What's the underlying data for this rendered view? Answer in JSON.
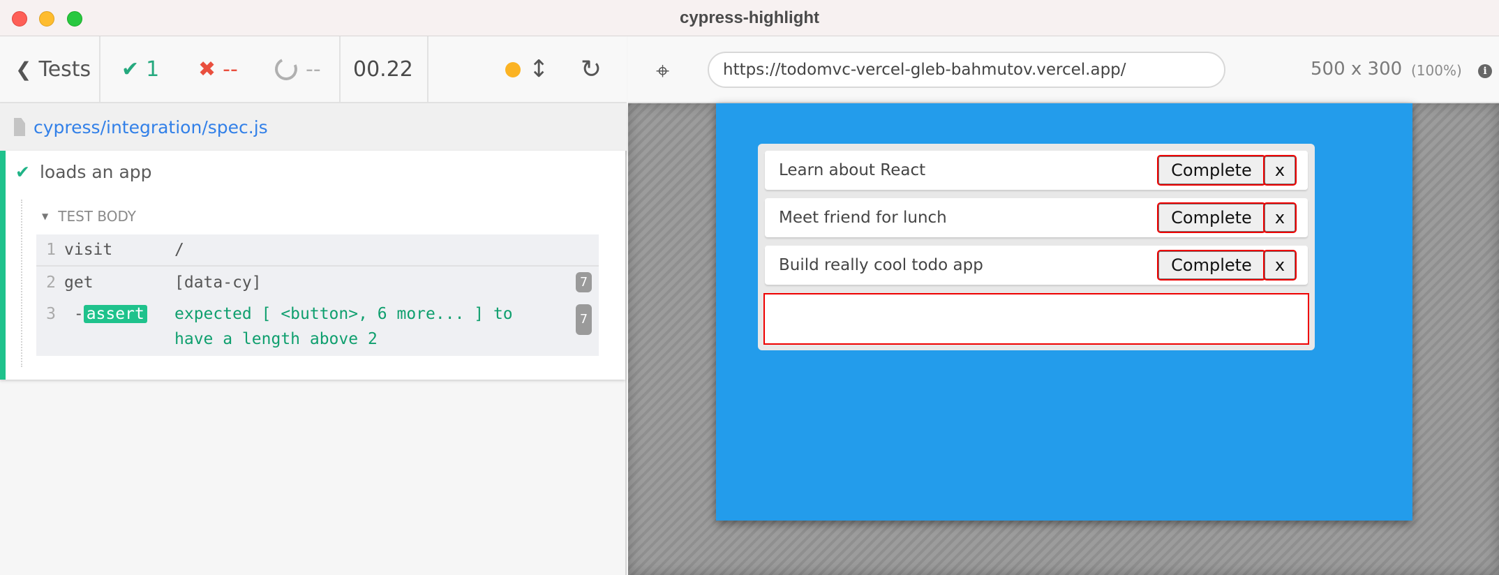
{
  "window": {
    "title": "cypress-highlight"
  },
  "reporter": {
    "back_label": "Tests",
    "stats": {
      "passed": "1",
      "failed": "--",
      "pending": "--"
    },
    "duration": "00.22",
    "spec_path": "cypress/integration/spec.js",
    "test": {
      "title": "loads an app",
      "hook_label": "TEST BODY",
      "commands": [
        {
          "number": "1",
          "name": "visit",
          "message": "/"
        },
        {
          "number": "2",
          "name": "get",
          "message": "[data-cy]",
          "count": "7"
        },
        {
          "number": "3",
          "name": "assert",
          "message": "expected [ <button>, 6 more... ] to have a length above 2",
          "count": "7"
        }
      ]
    }
  },
  "aut": {
    "url": "https://todomvc-vercel-gleb-bahmutov.vercel.app/",
    "viewport_size": "500 x 300",
    "viewport_scale": "(100%)",
    "todos": [
      {
        "text": "Learn about React",
        "complete_label": "Complete",
        "remove_label": "x"
      },
      {
        "text": "Meet friend for lunch",
        "complete_label": "Complete",
        "remove_label": "x"
      },
      {
        "text": "Build really cool todo app",
        "complete_label": "Complete",
        "remove_label": "x"
      }
    ],
    "new_todo_value": ""
  }
}
